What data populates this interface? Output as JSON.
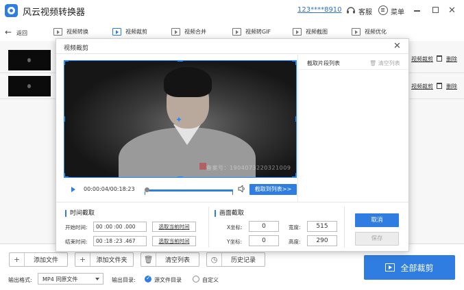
{
  "app": {
    "title": "风云视频转换器",
    "account": "123****8910",
    "service_label": "客服",
    "menu_label": "菜单"
  },
  "toolbar": {
    "back_label": "返回",
    "tools": [
      "视频转换",
      "视频裁剪",
      "视频合并",
      "视频转GIF",
      "视频截图",
      "视频优化"
    ],
    "active_tool": "视频裁剪"
  },
  "file_rows": [
    {
      "edit_label": "视频裁剪",
      "delete_label": "删除"
    },
    {
      "edit_label": "视频裁剪",
      "delete_label": "删除"
    }
  ],
  "dialog": {
    "title": "视频裁剪",
    "clip_list_title": "截取片段列表",
    "clear_list_label": "清空列表",
    "watermark": "备案号：1904073220321009",
    "timecode": "00:00:04/00:18:23",
    "add_to_list_label": "截取到列表>>",
    "time_section": {
      "title": "时间截取",
      "start_label": "开始时间:",
      "start_value": "00 :00 :00 .000",
      "end_label": "结束时间:",
      "end_value": "00 :18 :23 .467",
      "pick_current_label": "选取当前时间"
    },
    "frame_section": {
      "title": "画面截取",
      "x_label": "X坐标:",
      "x_value": "0",
      "y_label": "Y坐标:",
      "y_value": "0",
      "width_label": "宽度:",
      "width_value": "515",
      "height_label": "高度:",
      "height_value": "290"
    },
    "cancel_label": "取消",
    "save_label": "保存"
  },
  "bottom": {
    "add_file_label": "添加文件",
    "add_folder_label": "添加文件夹",
    "clear_list_label": "清空列表",
    "history_label": "历史记录",
    "crop_all_label": "全部裁剪",
    "output_format_label": "输出格式:",
    "output_format_value": "MP4 同原文件",
    "output_dir_label": "输出目录:",
    "dir_option_source": "源文件目录",
    "dir_option_custom": "自定义"
  },
  "colors": {
    "accent": "#2f7de1"
  }
}
